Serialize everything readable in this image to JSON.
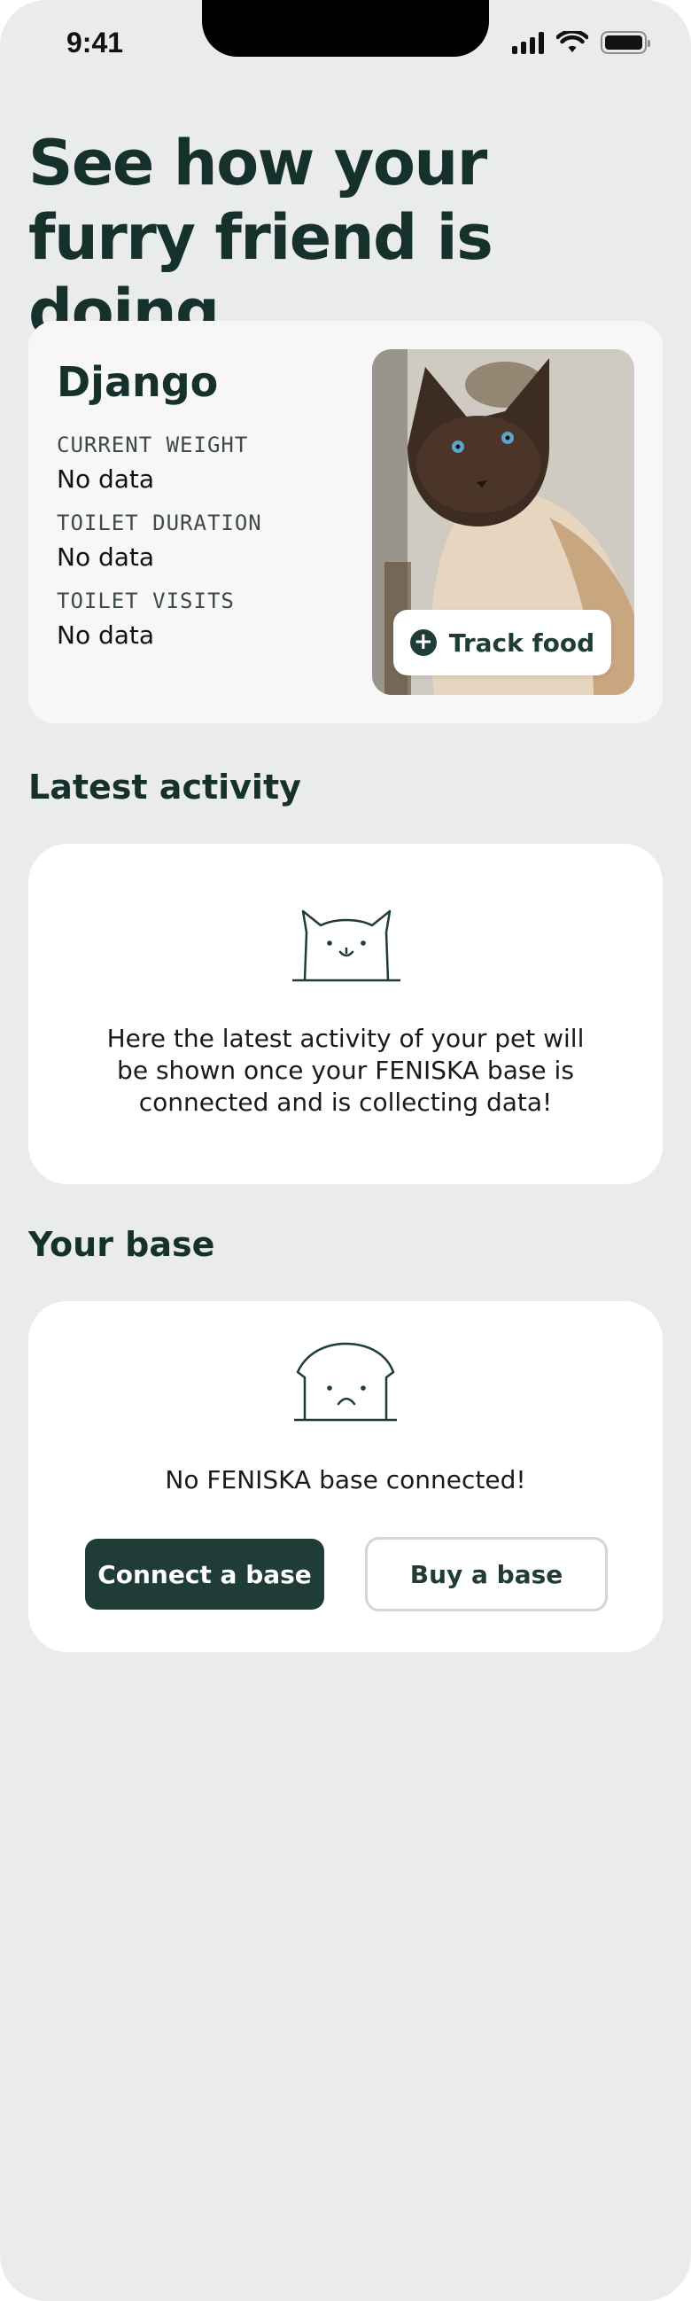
{
  "status_bar": {
    "time": "9:41"
  },
  "headline": "See how your furry friend is doing",
  "pet_card": {
    "name": "Django",
    "stats": [
      {
        "label": "CURRENT WEIGHT",
        "value": "No data"
      },
      {
        "label": "TOILET DURATION",
        "value": "No data"
      },
      {
        "label": "TOILET VISITS",
        "value": "No data"
      }
    ],
    "track_food_label": "Track food"
  },
  "latest_activity": {
    "title": "Latest activity",
    "message": "Here the latest activity of your pet will be shown once your FENISKA base is connected and is collecting data!"
  },
  "your_base": {
    "title": "Your base",
    "message": "No FENISKA base connected!",
    "connect_label": "Connect a base",
    "buy_label": "Buy a base"
  },
  "colors": {
    "background": "#eaeceb",
    "primary": "#1f3d36",
    "heading": "#16302b"
  },
  "icons": [
    "signal-icon",
    "wifi-icon",
    "battery-icon",
    "plus-icon",
    "cat-happy-icon",
    "cat-sad-icon"
  ]
}
